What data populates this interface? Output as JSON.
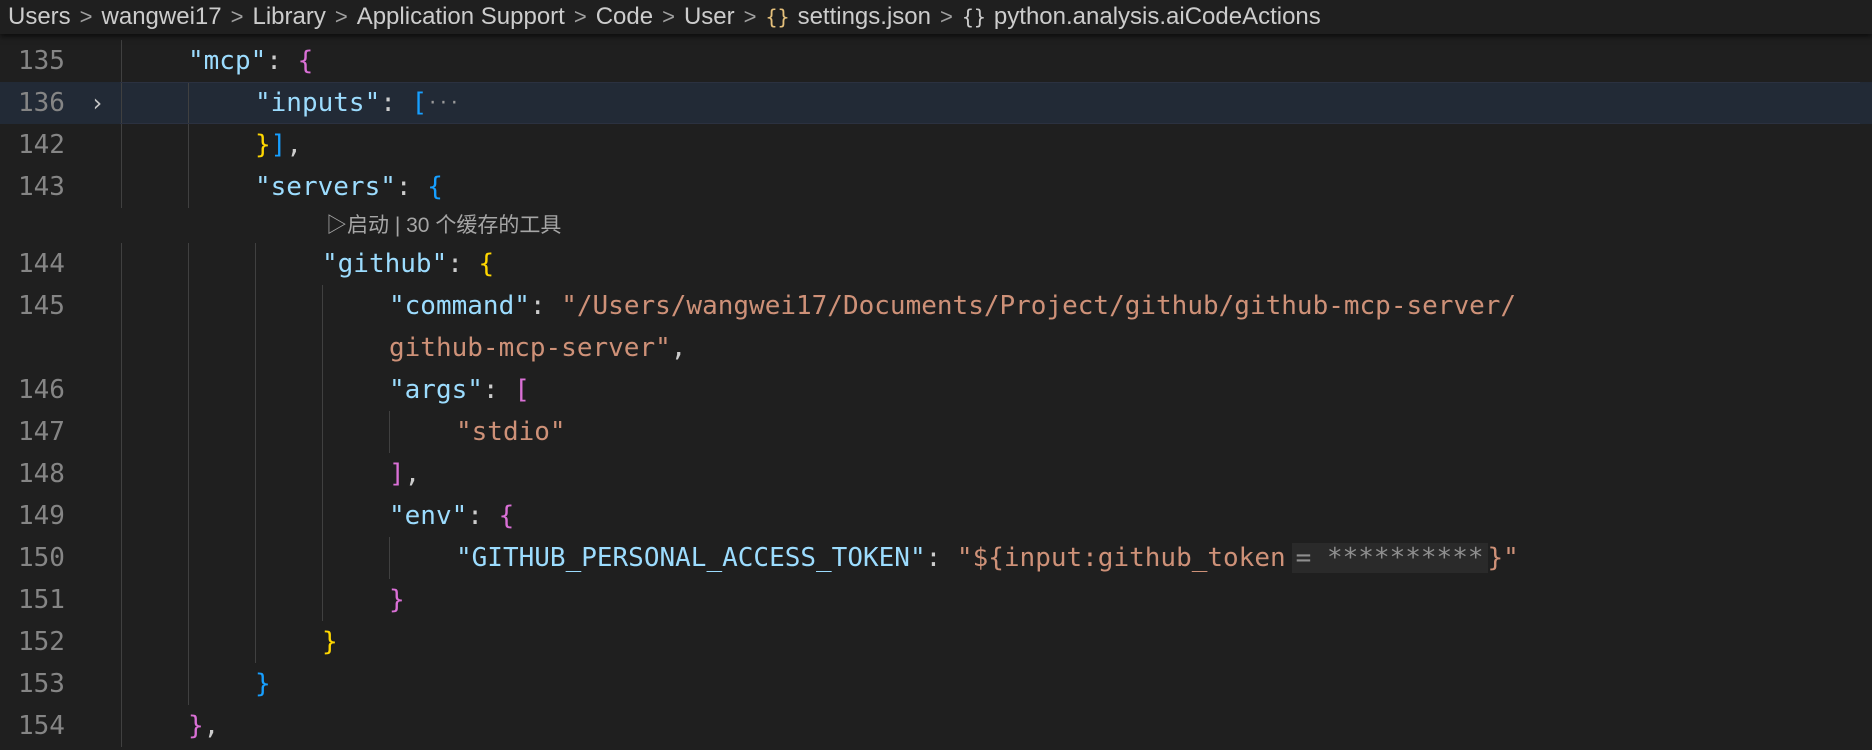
{
  "breadcrumb": {
    "items": [
      "Users",
      "wangwei17",
      "Library",
      "Application Support",
      "Code",
      "User"
    ],
    "file_icon": "{}",
    "file": "settings.json",
    "symbol_icon": "{}",
    "symbol": "python.analysis.aiCodeActions",
    "separator": ">"
  },
  "editor": {
    "line_numbers": [
      "135",
      "136",
      "142",
      "143",
      "144",
      "145",
      "146",
      "147",
      "148",
      "149",
      "150",
      "151",
      "152",
      "153",
      "154"
    ],
    "fold_icon": "›",
    "folded_ellipsis": "···",
    "codelens": "▷启动 | 30 个缓存的工具",
    "lines": {
      "l135_key": "\"mcp\"",
      "l136_key": "\"inputs\"",
      "l143_key": "\"servers\"",
      "l144_key": "\"github\"",
      "l145_key": "\"command\"",
      "l145_value": "\"/Users/wangwei17/Documents/Project/github/github-mcp-server/",
      "l145_wrap": "github-mcp-server\"",
      "l146_key": "\"args\"",
      "l147_value": "\"stdio\"",
      "l149_key": "\"env\"",
      "l150_key": "\"GITHUB_PERSONAL_ACCESS_TOKEN\"",
      "l150_value_start": "\"${input:github_token",
      "l150_inlay": "= **********",
      "l150_value_end": "}\""
    },
    "colors": {
      "background": "#1f1f1f",
      "key": "#9cdcfe",
      "string": "#ce9178",
      "bracket_gold": "#ffd700",
      "bracket_purple": "#da70d6",
      "bracket_blue": "#179fff",
      "active_line": "#222a36"
    }
  }
}
